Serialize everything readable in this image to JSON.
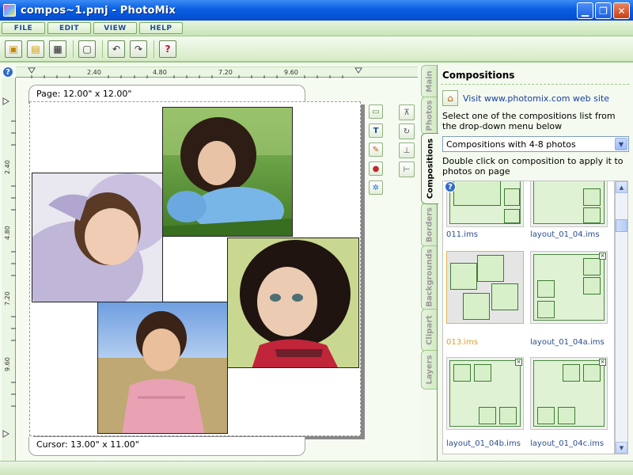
{
  "window": {
    "title": "compos~1.pmj - PhotoMix"
  },
  "menu": [
    "FILE",
    "EDIT",
    "VIEW",
    "HELP"
  ],
  "ruler": {
    "h_labels": [
      "2.40",
      "4.80",
      "7.20",
      "9.60"
    ],
    "v_labels": [
      "2.40",
      "4.80",
      "7.20",
      "9.60"
    ]
  },
  "page": {
    "size_label": "Page: 12.00\" x 12.00\"",
    "cursor_label": "Cursor: 13.00\" x 11.00\""
  },
  "tabs": [
    "Main",
    "Photos",
    "Compositions",
    "Borders",
    "Backgrounds",
    "Clipart",
    "Layers"
  ],
  "active_tab": "Compositions",
  "panel": {
    "title": "Compositions",
    "web_link": "Visit www.photomix.com web site",
    "instruction1": "Select one of the compositions list from the drop-down menu below",
    "dropdown_value": "Compositions with 4-8 photos",
    "instruction2": "Double click on composition to apply it to photos on page"
  },
  "compositions": [
    {
      "label": "011.ims"
    },
    {
      "label": "layout_01_04.ims"
    },
    {
      "label": "013.ims"
    },
    {
      "label": "layout_01_04a.ims"
    },
    {
      "label": "layout_01_04b.ims"
    },
    {
      "label": "layout_01_04c.ims"
    }
  ],
  "selected_composition": "013.ims",
  "colors": {
    "accent_green": "#9ec98a",
    "title_blue": "#0553d8",
    "link_blue": "#1a3ea0",
    "selected_orange": "#e6b34d"
  }
}
